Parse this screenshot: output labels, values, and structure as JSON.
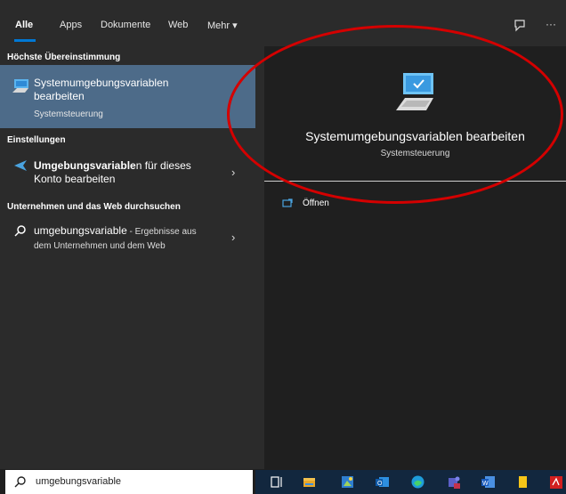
{
  "tabs": {
    "items": [
      "Alle",
      "Apps",
      "Dokumente",
      "Web",
      "Mehr ▾"
    ],
    "active": "Alle"
  },
  "sections": {
    "best_match": "Höchste Übereinstimmung",
    "settings": "Einstellungen",
    "web": "Unternehmen und das Web durchsuchen"
  },
  "best_match": {
    "title": "Systemumgebungsvariablen bearbeiten",
    "subtitle": "Systemsteuerung"
  },
  "settings_item": {
    "bold": "Umgebungsvariable",
    "rest": "n für dieses Konto bearbeiten"
  },
  "web_item": {
    "query": "umgebungsvariable",
    "rest": " - Ergebnisse aus dem Unternehmen und dem Web"
  },
  "detail": {
    "title": "Systemumgebungsvariablen bearbeiten",
    "subtitle": "Systemsteuerung",
    "open_label": "Öffnen"
  },
  "search": {
    "value": "umgebungsvariable"
  },
  "header_icons": [
    "feedback-icon",
    "more-icon"
  ],
  "taskbar_icons": [
    "task-view-icon",
    "file-explorer-icon",
    "photos-icon",
    "outlook-icon",
    "edge-icon",
    "teams-icon",
    "word-icon",
    "notes-icon",
    "acrobat-icon"
  ],
  "colors": {
    "accent": "#0078d4",
    "selected": "#4d6b89",
    "annotation": "#d40000",
    "taskbar": "#12273e"
  }
}
